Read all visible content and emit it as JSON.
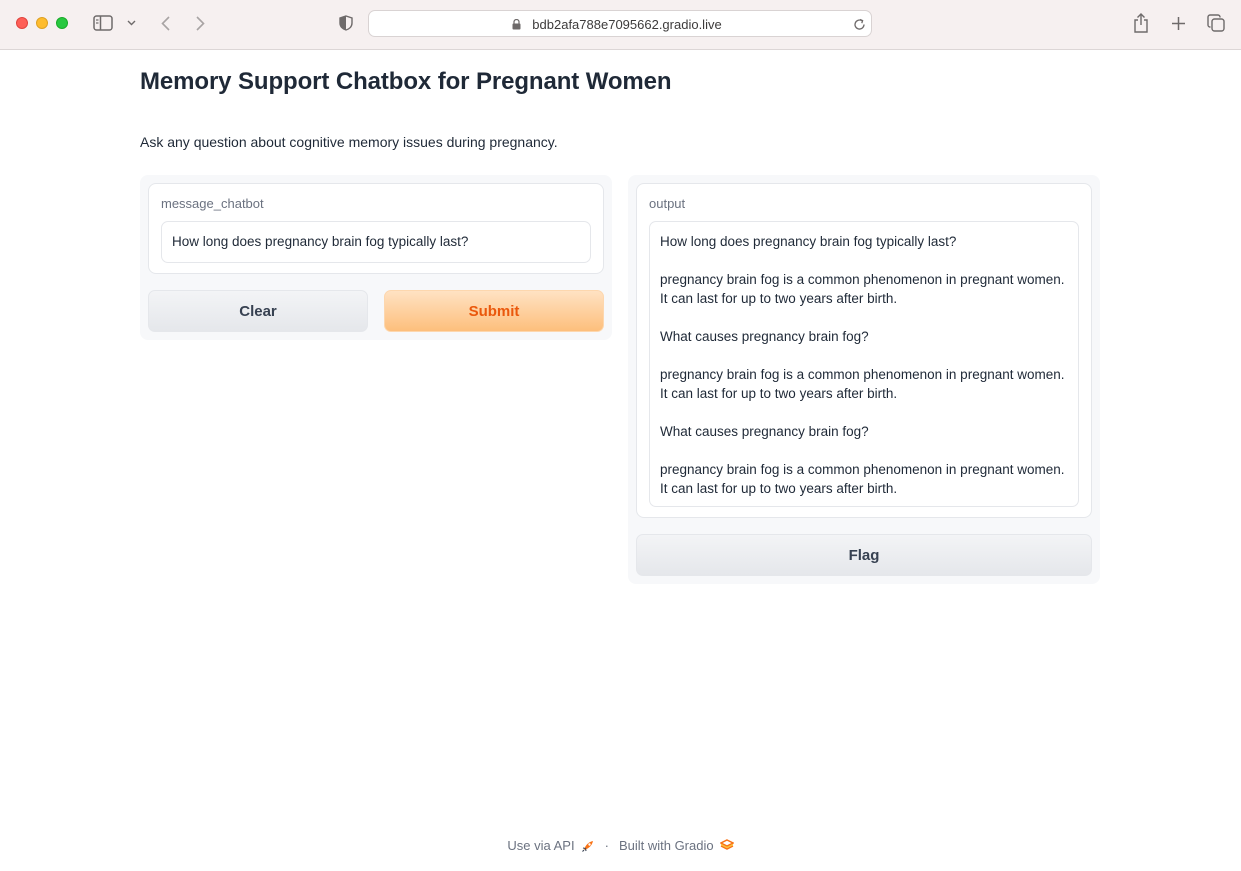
{
  "browser": {
    "url": "bdb2afa788e7095662.gradio.live",
    "icons": [
      "sidebar-icon",
      "chevron-down-icon",
      "back-icon",
      "forward-icon",
      "privacy-shield-icon",
      "lock-icon",
      "reload-icon",
      "share-icon",
      "new-tab-icon",
      "tab-overview-icon"
    ]
  },
  "app": {
    "title": "Memory Support Chatbox for Pregnant Women",
    "description": "Ask any question about cognitive memory issues during pregnancy."
  },
  "input_panel": {
    "label": "message_chatbot",
    "value": "How long does pregnancy brain fog typically last?",
    "clear_label": "Clear",
    "submit_label": "Submit"
  },
  "output_panel": {
    "label": "output",
    "value": "How long does pregnancy brain fog typically last?\n\npregnancy brain fog is a common phenomenon in pregnant women. It can last for up to two years after birth.\n\nWhat causes pregnancy brain fog?\n\npregnancy brain fog is a common phenomenon in pregnant women. It can last for up to two years after birth.\n\nWhat causes pregnancy brain fog?\n\npregnancy brain fog is a common phenomenon in pregnant women. It can last for up to two years after birth.",
    "flag_label": "Flag"
  },
  "footer": {
    "api_label": "Use via API",
    "separator": "·",
    "built_label": "Built with Gradio"
  },
  "colors": {
    "accent": "#ea580c",
    "primary_button_top": "#ffe2c3",
    "primary_button_bottom": "#fdbf7c"
  }
}
